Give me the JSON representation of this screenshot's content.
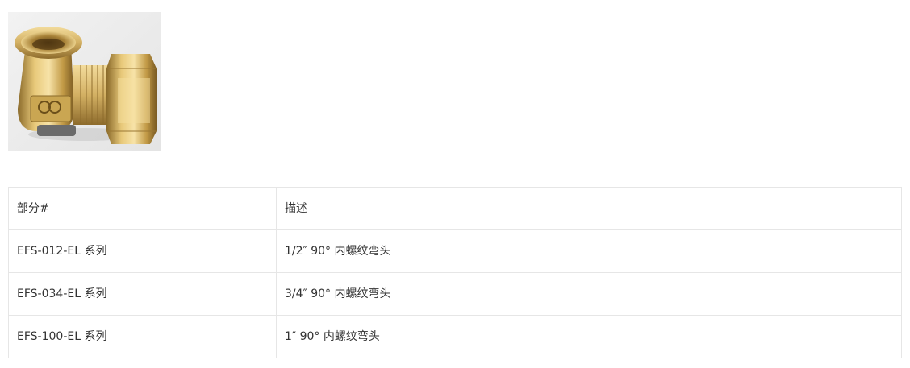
{
  "product": {
    "image_icon": "brass-elbow-fitting-photo"
  },
  "table": {
    "headers": {
      "part": "部分#",
      "description": "描述"
    },
    "rows": [
      {
        "part": "EFS-012-EL 系列",
        "description": "1/2″ 90° 内螺纹弯头"
      },
      {
        "part": "EFS-034-EL 系列",
        "description": "3/4″ 90° 内螺纹弯头"
      },
      {
        "part": "EFS-100-EL 系列",
        "description": "1″ 90° 内螺纹弯头"
      }
    ]
  }
}
